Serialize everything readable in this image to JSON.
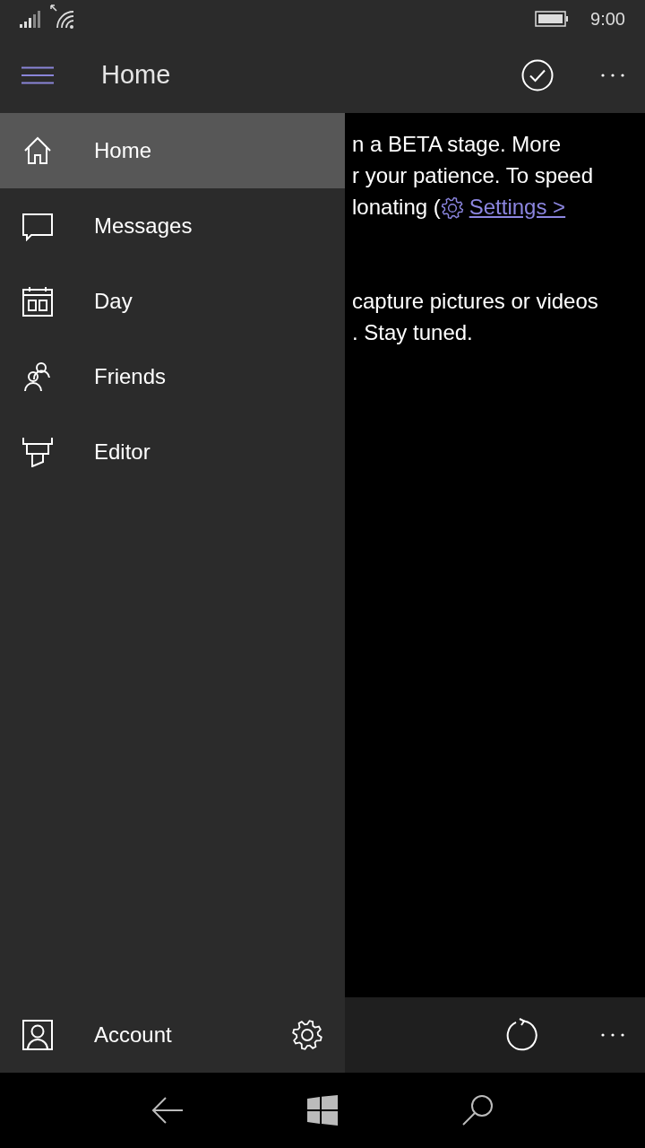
{
  "status_bar": {
    "time": "9:00"
  },
  "app_bar": {
    "title": "Home"
  },
  "content": {
    "lines": [
      {
        "text": "n a BETA stage. More"
      },
      {
        "text": "r your patience. To speed"
      },
      {
        "text": "lonating (",
        "link": "Settings >"
      },
      {
        "kind": "blank"
      },
      {
        "text": "capture pictures or videos"
      },
      {
        "text": ". Stay tuned."
      }
    ]
  },
  "drawer": {
    "items": [
      {
        "kind": "home",
        "label": "Home",
        "selected": true
      },
      {
        "kind": "messages",
        "label": "Messages",
        "selected": false
      },
      {
        "kind": "day",
        "label": "Day",
        "selected": false
      },
      {
        "kind": "friends",
        "label": "Friends",
        "selected": false
      },
      {
        "kind": "editor",
        "label": "Editor",
        "selected": false
      }
    ],
    "footer": {
      "label": "Account"
    }
  }
}
